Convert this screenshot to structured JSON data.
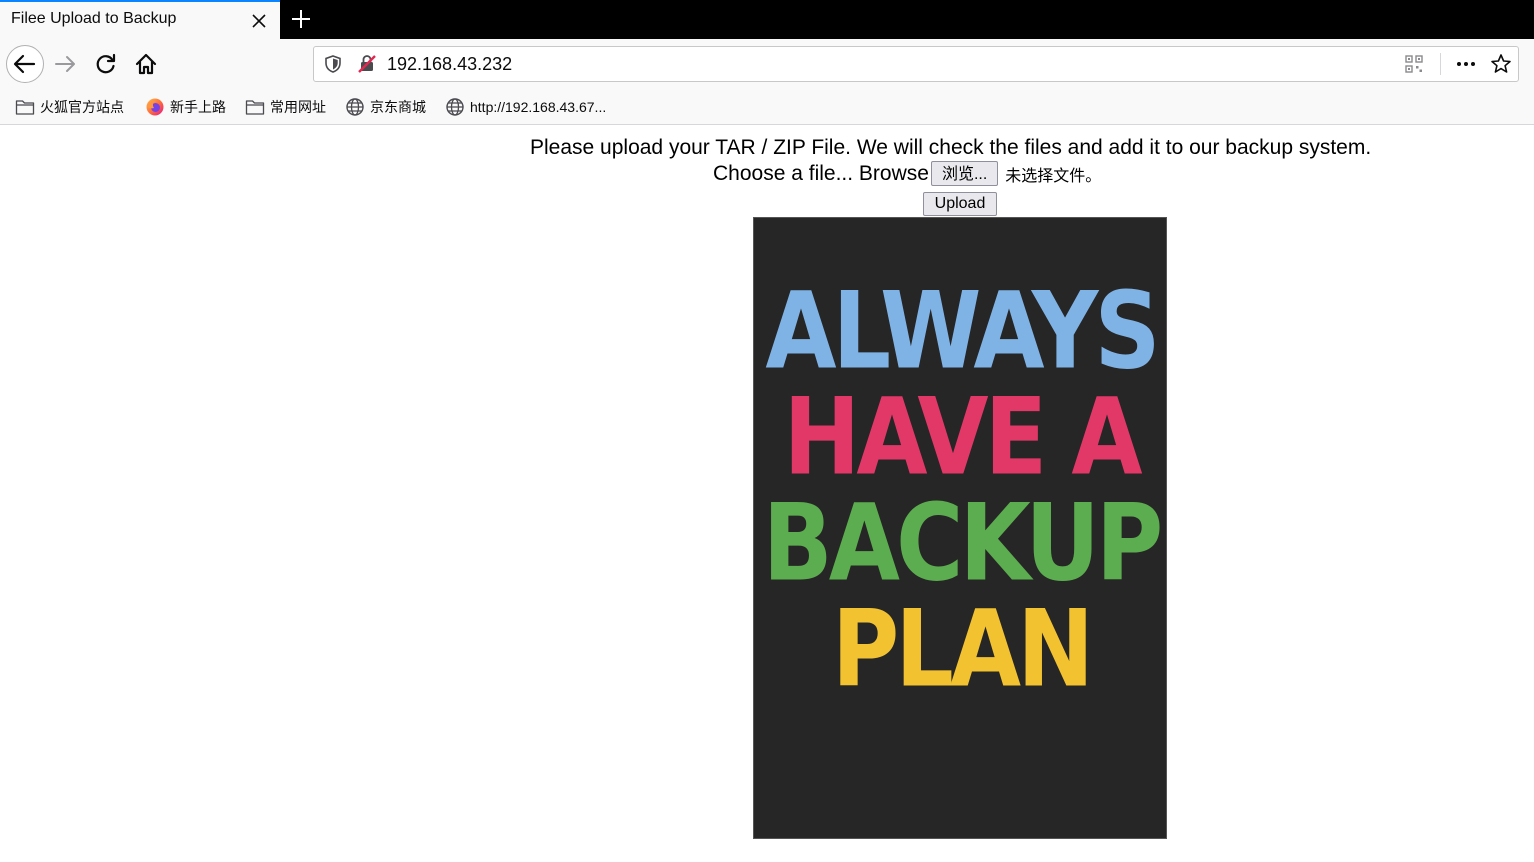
{
  "browser": {
    "tab": {
      "title": "Filee Upload to Backup"
    },
    "url": "192.168.43.232",
    "bookmarks": [
      {
        "label": "火狐官方站点",
        "icon": "folder-icon"
      },
      {
        "label": "新手上路",
        "icon": "firefox-icon"
      },
      {
        "label": "常用网址",
        "icon": "folder-icon"
      },
      {
        "label": "京东商城",
        "icon": "globe-icon"
      },
      {
        "label": "http://192.168.43.67...",
        "icon": "globe-icon"
      }
    ]
  },
  "page": {
    "heading": "Please upload your TAR / ZIP File. We will check the files and add it to our backup system.",
    "choose_label": "Choose a file... Browse",
    "browse_button": "浏览...",
    "no_file": "未选择文件。",
    "upload_button": "Upload",
    "poster": {
      "lines": [
        {
          "text": "ALWAYS",
          "color": "#7fb3e6"
        },
        {
          "text": "HAVE A",
          "color": "#e23868"
        },
        {
          "text": "BACKUP",
          "color": "#5cad4f"
        },
        {
          "text": "PLAN",
          "color": "#f2c230"
        }
      ]
    }
  }
}
